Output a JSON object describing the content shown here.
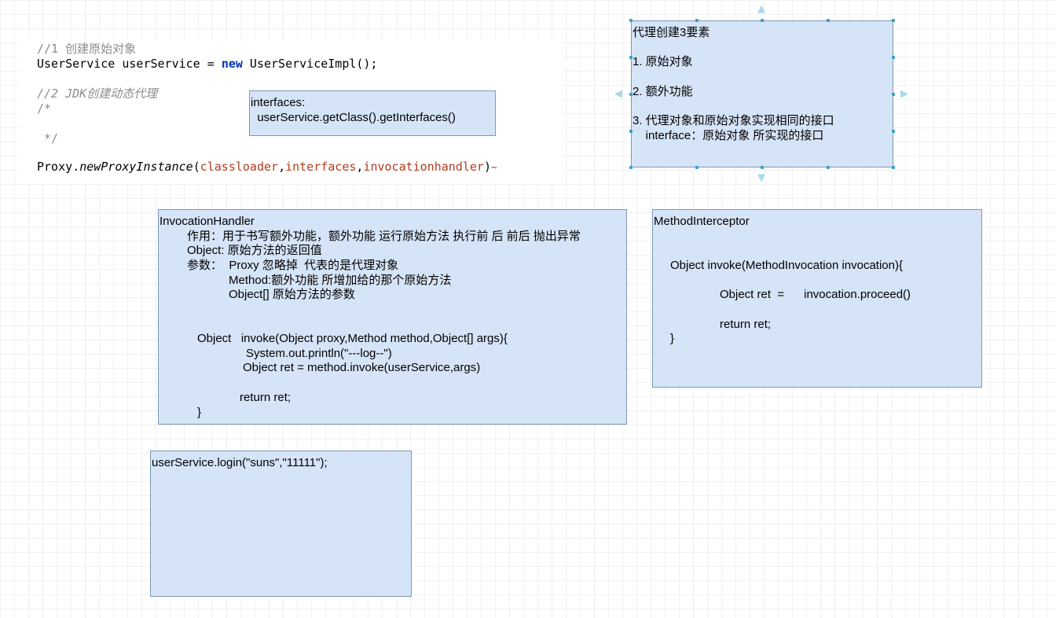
{
  "code": {
    "comment1": "//1 创建原始对象",
    "line_userservice_a": "UserService userService = ",
    "kw_new": "new",
    "line_userservice_b": " UserServiceImpl();",
    "comment2": "//2 JDK创建动态代理",
    "block_open": "/*",
    "block_close": " */",
    "proxy_prefix": "Proxy.",
    "proxy_method": "newProxyInstance",
    "paren_open": "(",
    "arg1": "classloader",
    "comma": ",",
    "arg2": "interfaces",
    "arg3": "invocationhandler",
    "paren_close": ")",
    "squiggle": "~"
  },
  "interfaces_box": {
    "line1": "interfaces:",
    "line2": "  userService.getClass().getInterfaces()"
  },
  "elements_box": {
    "title": "代理创建3要素",
    "item1": "1. 原始对象",
    "item2": "2. 额外功能",
    "item3": "3. 代理对象和原始对象实现相同的接口",
    "item3_detail": "    interface：原始对象 所实现的接口"
  },
  "invocation_handler_box": {
    "title": "InvocationHandler",
    "purpose": "作用：用于书写额外功能，额外功能 运行原始方法 执行前 后 前后 抛出异常",
    "object_line": "Object: 原始方法的返回值",
    "params_proxy": "参数：  Proxy 忽略掉  代表的是代理对象",
    "params_method": "Method:额外功能 所增加给的那个原始方法",
    "params_args": "Object[] 原始方法的参数",
    "invoke_sig": "Object   invoke(Object proxy,Method method,Object[] args){",
    "println": "System.out.println(\"---log--\")",
    "invoke_call": "Object ret = method.invoke(userService,args)",
    "return": "return ret;",
    "close": "}"
  },
  "method_interceptor_box": {
    "title": "MethodInterceptor",
    "invoke_sig": "Object invoke(MethodInvocation invocation){",
    "ret_line": "Object ret  =      invocation.proceed()",
    "return": "return ret;",
    "close": "}"
  },
  "login_box": {
    "line1": "userService.login(\"suns\",\"11111\");"
  },
  "colors": {
    "box_fill": "#d5e4f7",
    "box_border": "#7f98b4",
    "keyword": "#0033b3",
    "argument": "#b13c1e",
    "comment": "#8c8c8c",
    "selection_handle": "#3aa0c8"
  }
}
